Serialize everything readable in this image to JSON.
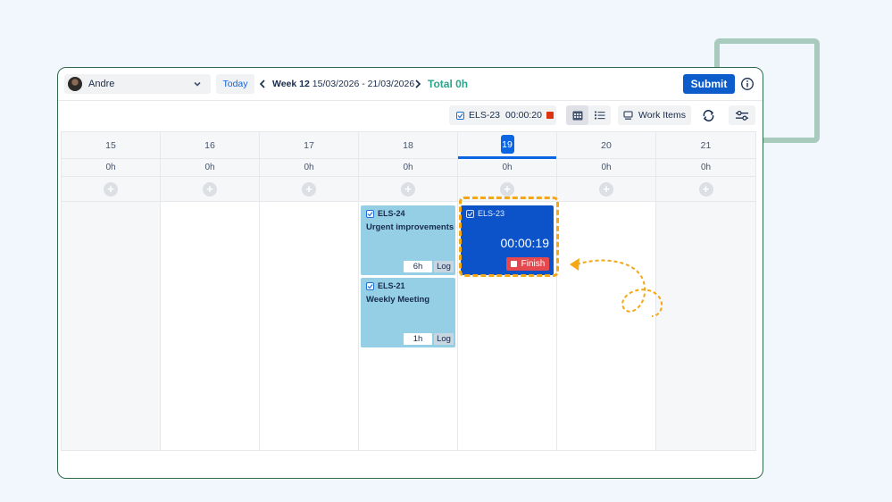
{
  "header": {
    "user_name": "Andre",
    "today_label": "Today",
    "week_label": "Week 12",
    "week_range": "15/03/2026 - 21/03/2026",
    "total_label": "Total 0h",
    "submit_label": "Submit"
  },
  "toolbar": {
    "timer_key": "ELS-23",
    "timer_time": "00:00:20",
    "work_items_label": "Work Items"
  },
  "days": [
    {
      "date": "15",
      "total": "0h"
    },
    {
      "date": "16",
      "total": "0h"
    },
    {
      "date": "17",
      "total": "0h"
    },
    {
      "date": "18",
      "total": "0h"
    },
    {
      "date": "19",
      "total": "0h"
    },
    {
      "date": "20",
      "total": "0h"
    },
    {
      "date": "21",
      "total": "0h"
    }
  ],
  "worklogs": [
    {
      "key": "ELS-24",
      "title": "Urgent improvements",
      "hours": "6h",
      "log_label": "Log"
    },
    {
      "key": "ELS-21",
      "title": "Weekly Meeting",
      "hours": "1h",
      "log_label": "Log"
    }
  ],
  "active_timer": {
    "key": "ELS-23",
    "time": "00:00:19",
    "finish_label": "Finish"
  },
  "colors": {
    "accent": "#0c66e4",
    "total_green": "#2aa58c",
    "worklog_card": "#95cfe6",
    "timer_card": "#0c52c9",
    "finish_red": "#e5484d",
    "highlight": "#f5a716"
  }
}
